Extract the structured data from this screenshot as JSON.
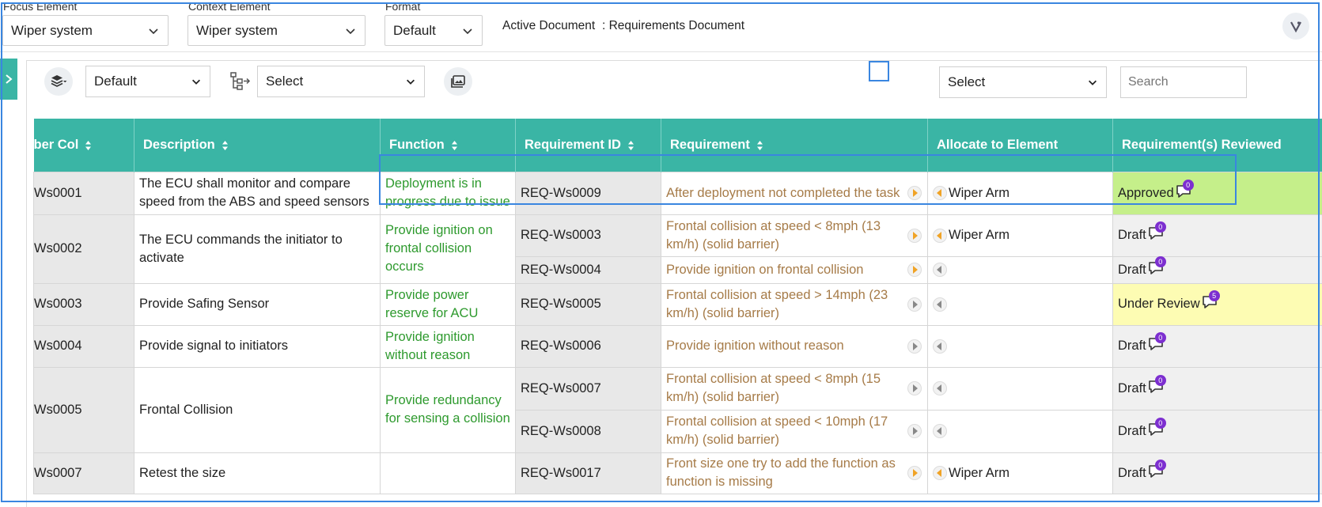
{
  "header": {
    "focus_label": "Focus Element",
    "focus_value": "Wiper system",
    "context_label": "Context Element",
    "context_value": "Wiper system",
    "format_label": "Format",
    "format_value": "Default",
    "active_doc_label": "Active Document",
    "active_doc_value": ": Requirements Document"
  },
  "toolbar": {
    "view_select": "Default",
    "tree_select": "Select",
    "right_select": "Select",
    "search_placeholder": "Search"
  },
  "table": {
    "columns": [
      "ber Col",
      "Description",
      "Function",
      "Requirement ID",
      "Requirement",
      "Allocate to Element",
      "Requirement(s) Reviewed"
    ],
    "rows": [
      {
        "num": "Ws0001",
        "desc": "The ECU shall monitor and compare speed from the ABS and speed sensors",
        "fn": "Deployment is in progress due to issue",
        "reqs": [
          {
            "id": "REQ-Ws0009",
            "text": "After deployment not completed the task",
            "alloc": "Wiper Arm",
            "status": "Approved",
            "count": "0",
            "kind": "approved"
          }
        ]
      },
      {
        "num": "Ws0002",
        "desc": "The ECU commands the initiator to activate",
        "fn": "Provide ignition on frontal collision occurs",
        "reqs": [
          {
            "id": "REQ-Ws0003",
            "text": "Frontal collision at speed < 8mph (13 km/h) (solid barrier)",
            "alloc": "Wiper Arm",
            "status": "Draft",
            "count": "0",
            "kind": "draft"
          },
          {
            "id": "REQ-Ws0004",
            "text": "Provide ignition on frontal collision",
            "alloc": "",
            "status": "Draft",
            "count": "0",
            "kind": "draft"
          }
        ]
      },
      {
        "num": "Ws0003",
        "desc": "Provide Safing Sensor",
        "fn": "Provide power reserve for ACU",
        "reqs": [
          {
            "id": "REQ-Ws0005",
            "text": "Frontal collision at speed > 14mph (23 km/h) (solid barrier)",
            "alloc": "",
            "status": "Under Review",
            "count": "5",
            "kind": "review"
          }
        ]
      },
      {
        "num": "Ws0004",
        "desc": "Provide signal to initiators",
        "fn": "Provide ignition without reason",
        "reqs": [
          {
            "id": "REQ-Ws0006",
            "text": "Provide ignition without reason",
            "alloc": "",
            "status": "Draft",
            "count": "0",
            "kind": "draft"
          }
        ]
      },
      {
        "num": "Ws0005",
        "desc": "Frontal Collision",
        "fn": "Provide redundancy for sensing a collision",
        "reqs": [
          {
            "id": "REQ-Ws0007",
            "text": "Frontal collision at speed < 8mph (15 km/h) (solid barrier)",
            "alloc": "",
            "status": "Draft",
            "count": "0",
            "kind": "draft"
          },
          {
            "id": "REQ-Ws0008",
            "text": "Frontal collision at speed < 10mph (17 km/h) (solid barrier)",
            "alloc": "",
            "status": "Draft",
            "count": "0",
            "kind": "draft"
          }
        ]
      },
      {
        "num": "Ws0007",
        "desc": "Retest the size",
        "fn": "",
        "reqs": [
          {
            "id": "REQ-Ws0017",
            "text": "Front size one try to add the function as function is missing",
            "alloc": "Wiper Arm",
            "status": "Draft",
            "count": "0",
            "kind": "draft"
          }
        ]
      }
    ]
  },
  "colors": {
    "teal": "#3ab5a5",
    "focus_blue": "#3a86e0",
    "function_green": "#2e9a2e",
    "requirement_brown": "#a67b48",
    "approved_bg": "#c5ef8a",
    "review_bg": "#fdfcb3",
    "badge_purple": "#7d2fd0"
  },
  "icons": [
    "chevron-down-icon",
    "layers-icon",
    "hierarchy-icon",
    "image-icon",
    "vee-icon",
    "comment-icon",
    "sort-icon",
    "play-icon",
    "back-icon",
    "expand-icon"
  ]
}
